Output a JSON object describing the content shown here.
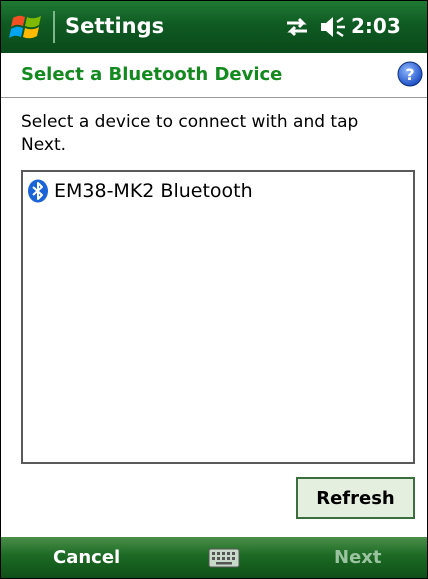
{
  "titlebar": {
    "title": "Settings",
    "clock": "2:03",
    "icons": [
      "windows-flag-icon",
      "connectivity-icon",
      "volume-icon"
    ]
  },
  "header": {
    "title": "Select a Bluetooth Device",
    "help_icon": "help-icon"
  },
  "instruction": "Select a device to connect with and tap Next.",
  "devices": [
    {
      "label": "EM38-MK2 Bluetooth",
      "icon": "bluetooth-icon"
    }
  ],
  "buttons": {
    "refresh": "Refresh"
  },
  "softkeys": {
    "left": "Cancel",
    "right": "Next",
    "center_icon": "keyboard-icon"
  },
  "colors": {
    "titlebar": "#0f5a22",
    "header_text": "#13891f",
    "button_bg": "#e4efdf",
    "softkey_disabled_text": "#9cc3a0"
  }
}
